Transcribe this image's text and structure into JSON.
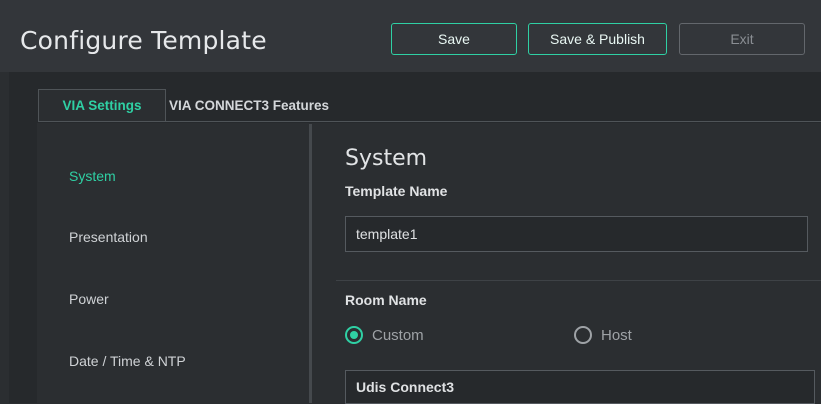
{
  "header": {
    "title": "Configure Template",
    "save_label": "Save",
    "save_publish_label": "Save & Publish",
    "exit_label": "Exit"
  },
  "tabs": [
    {
      "label": "VIA Settings",
      "active": true
    },
    {
      "label": "VIA CONNECT3 Features",
      "active": false
    }
  ],
  "sidebar": {
    "items": [
      {
        "label": "System",
        "active": true
      },
      {
        "label": "Presentation",
        "active": false
      },
      {
        "label": "Power",
        "active": false
      },
      {
        "label": "Date / Time & NTP",
        "active": false
      }
    ]
  },
  "content": {
    "section_title": "System",
    "template_name_label": "Template Name",
    "template_name_value": "template1",
    "room_name_label": "Room Name",
    "room_name_options": [
      {
        "label": "Custom",
        "selected": true
      },
      {
        "label": "Host",
        "selected": false
      }
    ],
    "room_name_value": "Udis Connect3"
  },
  "colors": {
    "accent": "#2fd0a4",
    "background": "#2b2e31",
    "header_bg": "#33363a"
  }
}
